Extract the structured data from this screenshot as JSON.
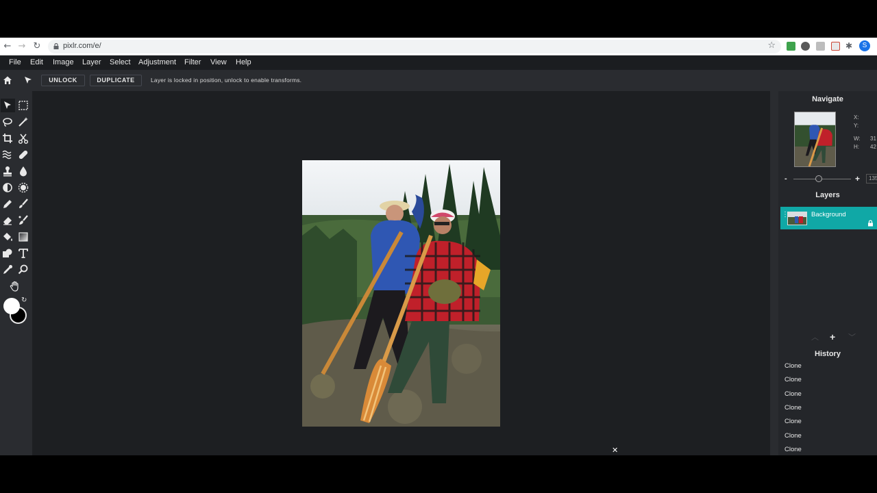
{
  "browser": {
    "url": "pixlr.com/e/",
    "profile_initial": "S"
  },
  "menu": [
    "File",
    "Edit",
    "Image",
    "Layer",
    "Select",
    "Adjustment",
    "Filter",
    "View",
    "Help"
  ],
  "toolbar": {
    "unlock_label": "UNLOCK",
    "duplicate_label": "DUPLICATE",
    "message": "Layer is locked in position, unlock to enable transforms."
  },
  "navigate": {
    "title": "Navigate",
    "x_label": "X:",
    "y_label": "Y:",
    "w_label": "W:",
    "h_label": "H:",
    "w_value": "31",
    "h_value": "42",
    "zoom_minus": "-",
    "zoom_plus": "+",
    "zoom_value": "135"
  },
  "layers": {
    "title": "Layers",
    "items": [
      {
        "name": "Background"
      }
    ]
  },
  "history": {
    "title": "History",
    "items": [
      "Clone",
      "Clone",
      "Clone",
      "Clone",
      "Clone",
      "Clone",
      "Clone"
    ]
  },
  "colors": {
    "accent": "#10a8a6",
    "foreground": "#ffffff",
    "background": "#000000"
  }
}
